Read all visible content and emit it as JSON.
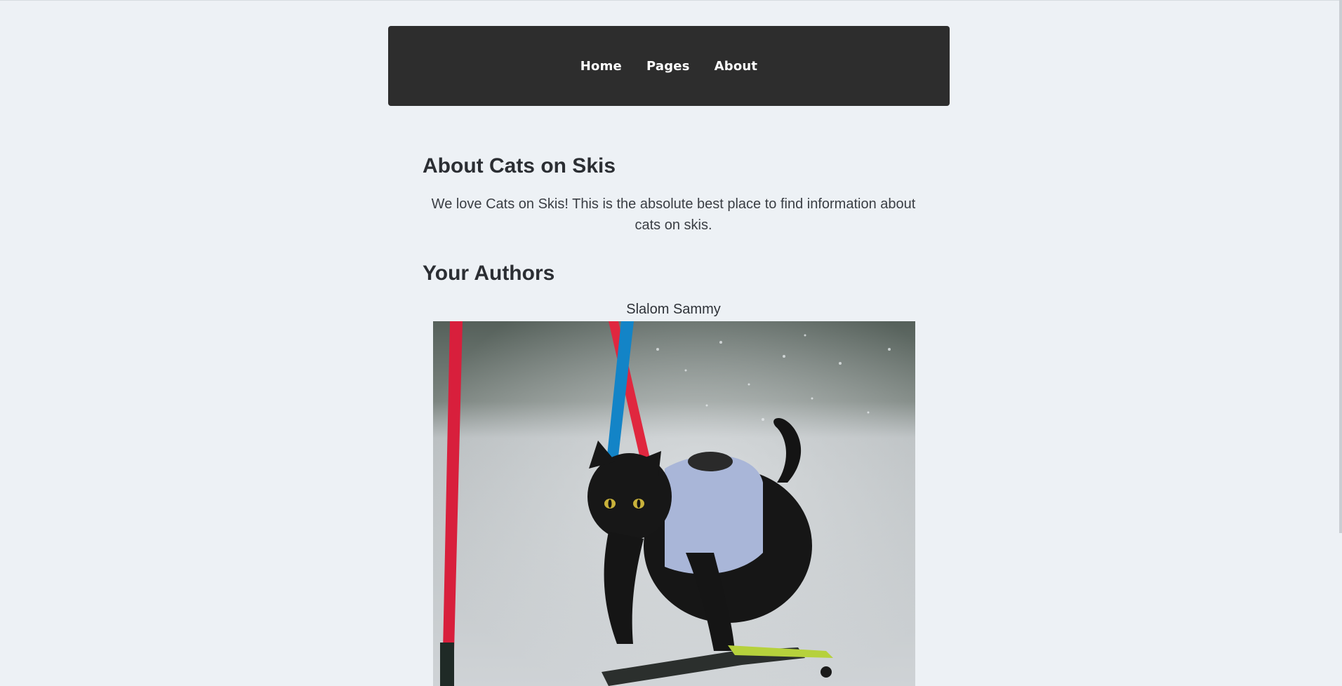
{
  "nav": {
    "home": "Home",
    "pages": "Pages",
    "about": "About"
  },
  "about": {
    "title": "About Cats on Skis",
    "intro": "We love Cats on Skis! This is the absolute best place to find information about cats on skis."
  },
  "authors": {
    "title": "Your Authors",
    "items": [
      {
        "name": "Slalom Sammy",
        "photo_icon": "skiing-cat-photo"
      }
    ]
  },
  "colors": {
    "background": "#edf1f5",
    "navbar": "#2d2d2d",
    "text": "#2b2e33"
  }
}
